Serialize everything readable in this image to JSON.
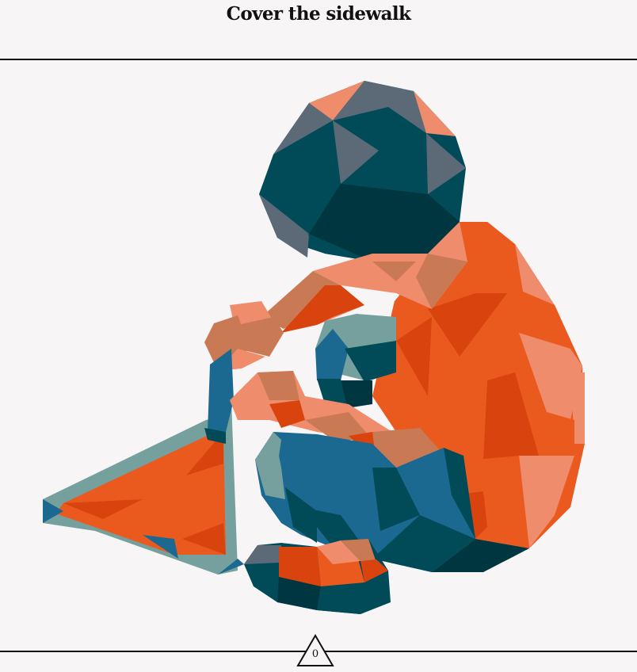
{
  "header": {
    "title": "Cover the sidewalk"
  },
  "illustration": {
    "icon": "low-poly-figure-sitting-with-chalk-triangle",
    "colors": {
      "orange": "#ea5a1f",
      "dark_orange": "#d9430e",
      "salmon": "#ef8c6c",
      "tan": "#c97a55",
      "dark_teal": "#004b57",
      "deep_teal": "#003640",
      "slate": "#5c6a78",
      "blue": "#1b6890",
      "sage": "#76a09e"
    }
  },
  "footer": {
    "page_number": "0",
    "icon": "triangle-page-indicator-icon"
  },
  "colors": {
    "background": "#f7f5f6",
    "rule": "#111111",
    "text": "#111111"
  }
}
